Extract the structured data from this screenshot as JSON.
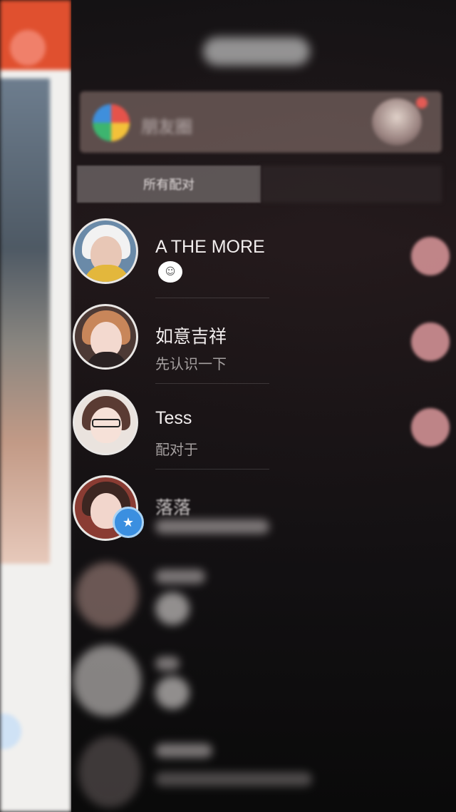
{
  "colors": {
    "header_red": "#e0502f",
    "tab_active_bg": "#787070",
    "unread_dot": "#e8a0a4",
    "badge_blue": "#3b8fe0"
  },
  "panel": {
    "title": "",
    "moments": {
      "label": "朋友圈",
      "icon": "moments-icon"
    },
    "tabs": [
      {
        "label": "所有配对",
        "active": true
      },
      {
        "label": "",
        "active": false
      }
    ]
  },
  "chats": [
    {
      "name": "A THE MORE",
      "preview": "",
      "emoji": "☺",
      "unread": true
    },
    {
      "name": "如意吉祥",
      "preview": "先认识一下",
      "unread": true
    },
    {
      "name": "Tess",
      "preview": "配对于",
      "unread": true
    },
    {
      "name": "落落",
      "preview": "",
      "badge": "star-icon",
      "unread": false
    },
    {
      "name": "",
      "preview": "",
      "unread": false
    },
    {
      "name": "",
      "preview": "",
      "unread": false
    },
    {
      "name": "",
      "preview": "",
      "unread": false
    }
  ]
}
